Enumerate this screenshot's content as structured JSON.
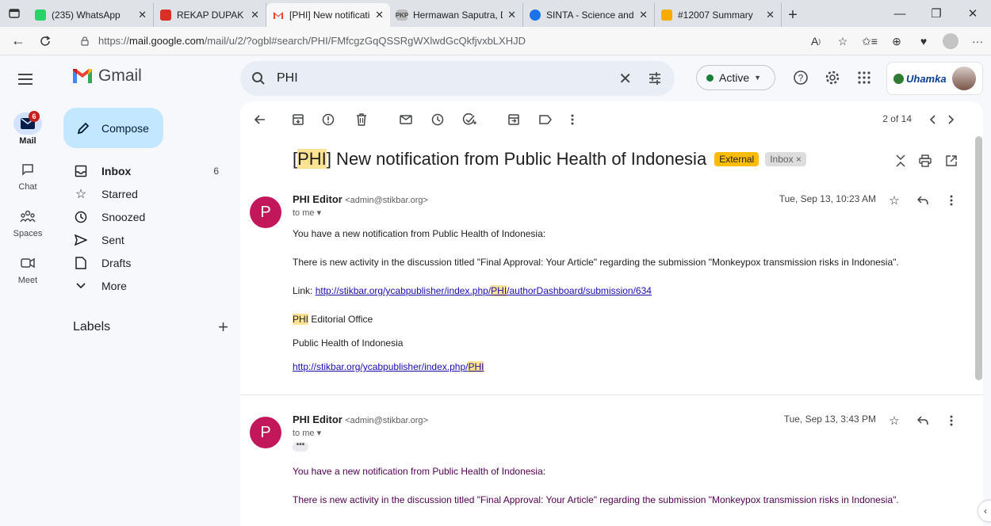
{
  "browser": {
    "tabs": [
      {
        "title": "(235) WhatsApp",
        "favicon": "whatsapp-favicon",
        "color": "#25d366"
      },
      {
        "title": "REKAP DUPAK BIDANG",
        "favicon": "pdf-favicon",
        "color": "#d93025"
      },
      {
        "title": "[PHI] New notification",
        "favicon": "gmail-favicon",
        "color": "#ea4335",
        "active": true
      },
      {
        "title": "Hermawan Saputra, D",
        "favicon": "pkp-favicon",
        "color": "#9e9e9e"
      },
      {
        "title": "SINTA - Science and Te",
        "favicon": "sinta-favicon",
        "color": "#1a73e8"
      },
      {
        "title": "#12007 Summary",
        "favicon": "journal-favicon",
        "color": "#f9ab00"
      }
    ],
    "url_prefix": "https://",
    "url_domain": "mail.google.com",
    "url_rest": "/mail/u/2/?ogbl#search/PHI/FMfcgzGqQSSRgWXlwdGcQkfjvxbLXHJD"
  },
  "header": {
    "logo_text": "Gmail",
    "search_value": "PHI",
    "status_label": "Active",
    "account_logo": "Uhamka"
  },
  "rail": {
    "mail_label": "Mail",
    "mail_badge": "6",
    "chat_label": "Chat",
    "spaces_label": "Spaces",
    "meet_label": "Meet"
  },
  "nav": {
    "compose_label": "Compose",
    "items": [
      {
        "label": "Inbox",
        "count": "6"
      },
      {
        "label": "Starred",
        "count": ""
      },
      {
        "label": "Snoozed",
        "count": ""
      },
      {
        "label": "Sent",
        "count": ""
      },
      {
        "label": "Drafts",
        "count": ""
      },
      {
        "label": "More",
        "count": ""
      }
    ],
    "labels_heading": "Labels"
  },
  "thread": {
    "pager": "2 of 14",
    "subject_tag": "PHI",
    "subject_rest": " New notification from Public Health of Indonesia",
    "external_chip": "External",
    "inbox_chip": "Inbox ×",
    "messages": [
      {
        "sender_name": "PHI Editor",
        "sender_email": "<admin@stikbar.org>",
        "to": "to me",
        "date": "Tue, Sep 13, 10:23 AM",
        "avatar": "P",
        "line1": "You have a new notification from Public Health of Indonesia:",
        "line2": "There is new activity in the discussion titled \"Final Approval: Your Article\" regarding the submission \"Monkeypox transmission risks in Indonesia\".",
        "link_label": "Link: ",
        "link_pre": "http://stikbar.org/ycabpublisher/index.php/",
        "link_hl": "PHI",
        "link_post": "/authorDashboard/submission/634",
        "office_hl": "PHI",
        "office_rest": " Editorial Office",
        "journal": "Public Health of Indonesia",
        "journal_link_pre": "http://stikbar.org/ycabpublisher/index.php/",
        "journal_link_hl": "PHI"
      },
      {
        "sender_name": "PHI Editor",
        "sender_email": "<admin@stikbar.org>",
        "to": "to me",
        "date": "Tue, Sep 13, 3:43 PM",
        "avatar": "P",
        "ellipsis": "•••",
        "line1": "You have a new notification from Public Health of Indonesia:",
        "line2": "There is new activity in the discussion titled \"Final Approval: Your Article\" regarding the submission \"Monkeypox transmission risks in Indonesia\"."
      }
    ]
  },
  "colors": {
    "compose_bg": "#c2e7ff",
    "highlight": "#fde293",
    "external_chip": "#fbbc04",
    "avatar": "#c2185b",
    "status_green": "#188038",
    "badge_red": "#c5221f"
  }
}
